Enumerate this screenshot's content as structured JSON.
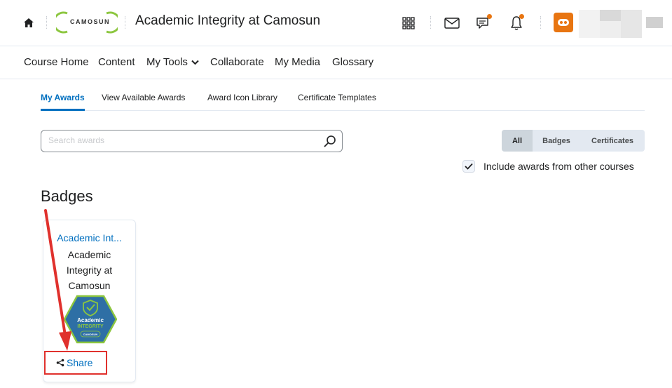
{
  "header": {
    "course_title": "Academic Integrity at Camosun",
    "logo_text": "CAMOSUN",
    "icons": [
      "home-icon",
      "app-grid-icon",
      "mail-icon",
      "chat-icon",
      "bell-icon",
      "avatar-icon"
    ],
    "accent_color": "#e87511"
  },
  "nav": {
    "items": [
      {
        "label": "Course Home"
      },
      {
        "label": "Content"
      },
      {
        "label": "My Tools"
      },
      {
        "label": "Collaborate"
      },
      {
        "label": "My Media"
      },
      {
        "label": "Glossary"
      }
    ]
  },
  "tabs": [
    {
      "label": "My Awards",
      "active": true
    },
    {
      "label": "View Available Awards"
    },
    {
      "label": "Award Icon Library"
    },
    {
      "label": "Certificate Templates"
    }
  ],
  "search": {
    "placeholder": "Search awards",
    "value": ""
  },
  "filters": [
    {
      "label": "All",
      "active": true
    },
    {
      "label": "Badges"
    },
    {
      "label": "Certificates"
    }
  ],
  "include_other_courses": {
    "label": "Include awards from other courses",
    "checked": true
  },
  "section_title": "Badges",
  "badge": {
    "link_text": "Academic Int...",
    "name": "Academic Integrity at Camosun",
    "image_line1": "Academic",
    "image_line2": "INTEGRITY",
    "image_footer": "CAMOSUN",
    "share_label": "Share"
  },
  "colors": {
    "link": "#006fbf",
    "annotation": "#e0312d",
    "badge_fill": "#2e6fa5",
    "badge_border": "#8cc63f"
  }
}
